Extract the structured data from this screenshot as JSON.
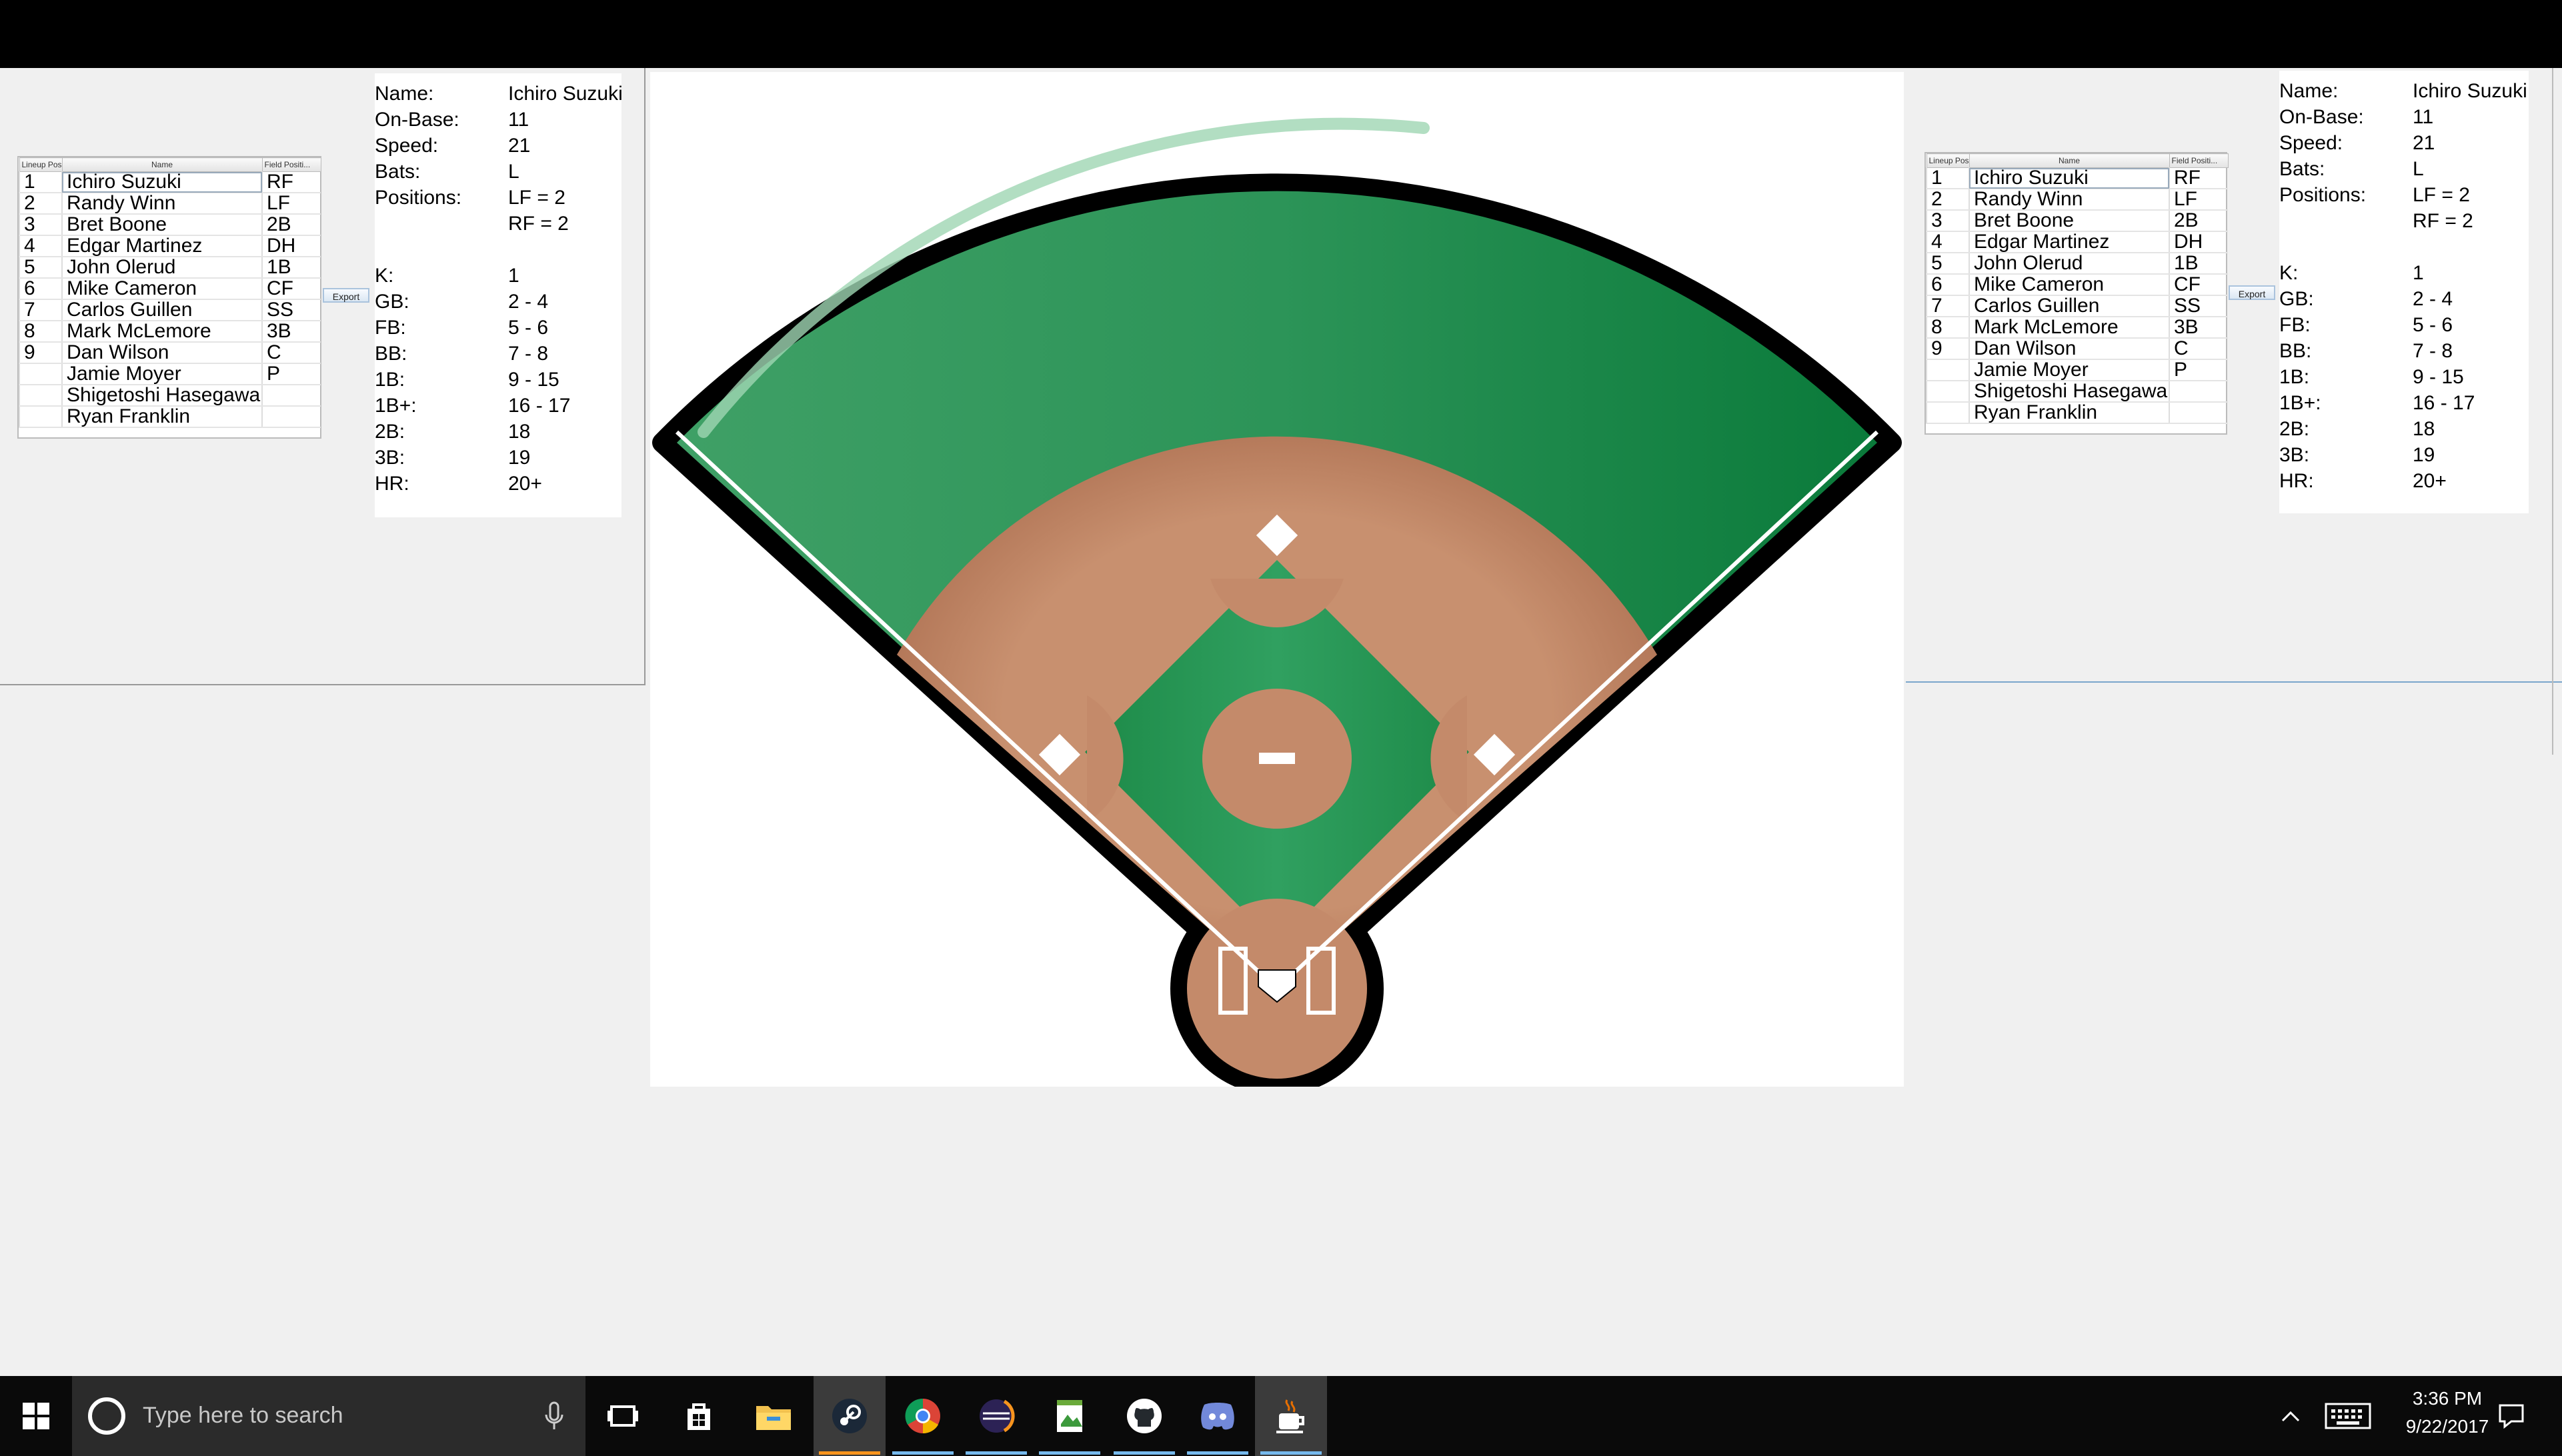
{
  "lineup": {
    "headers": [
      "Lineup Pos...",
      "Name",
      "Field Positi..."
    ],
    "rows": [
      {
        "pos": "1",
        "name": "Ichiro Suzuki",
        "field": "RF"
      },
      {
        "pos": "2",
        "name": "Randy Winn",
        "field": "LF"
      },
      {
        "pos": "3",
        "name": "Bret Boone",
        "field": "2B"
      },
      {
        "pos": "4",
        "name": "Edgar Martinez",
        "field": "DH"
      },
      {
        "pos": "5",
        "name": "John Olerud",
        "field": "1B"
      },
      {
        "pos": "6",
        "name": "Mike Cameron",
        "field": "CF"
      },
      {
        "pos": "7",
        "name": "Carlos Guillen",
        "field": "SS"
      },
      {
        "pos": "8",
        "name": "Mark McLemore",
        "field": "3B"
      },
      {
        "pos": "9",
        "name": "Dan Wilson",
        "field": "C"
      },
      {
        "pos": "",
        "name": "Jamie Moyer",
        "field": "P"
      },
      {
        "pos": "",
        "name": "Shigetoshi Hasegawa",
        "field": ""
      },
      {
        "pos": "",
        "name": "Ryan Franklin",
        "field": ""
      }
    ]
  },
  "export_label": "Export",
  "stats": {
    "rows": [
      {
        "label": "Name:",
        "value": "Ichiro Suzuki"
      },
      {
        "label": "On-Base:",
        "value": "11"
      },
      {
        "label": "Speed:",
        "value": "21"
      },
      {
        "label": "Bats:",
        "value": "L"
      },
      {
        "label": "Positions:",
        "value": "LF = 2"
      },
      {
        "label": "",
        "value": "RF = 2"
      },
      {
        "label": "",
        "value": ""
      },
      {
        "label": "K:",
        "value": "1"
      },
      {
        "label": "GB:",
        "value": "2 - 4"
      },
      {
        "label": "FB:",
        "value": "5 - 6"
      },
      {
        "label": "BB:",
        "value": "7 - 8"
      },
      {
        "label": "1B:",
        "value": "9 - 15"
      },
      {
        "label": "1B+:",
        "value": "16 - 17"
      },
      {
        "label": "2B:",
        "value": "18"
      },
      {
        "label": "3B:",
        "value": "19"
      },
      {
        "label": "HR:",
        "value": "20+"
      }
    ]
  },
  "taskbar": {
    "search_placeholder": "Type here to search",
    "time": "3:36 PM",
    "date": "9/22/2017",
    "apps": [
      "task-view-icon",
      "store-icon",
      "file-explorer-icon",
      "steam-icon",
      "chrome-icon",
      "eclipse-icon",
      "notepad-icon",
      "github-icon",
      "discord-icon",
      "java-icon"
    ]
  },
  "colors": {
    "grass": "#1f8a4c",
    "dirt": "#c48a6a",
    "outline": "#000000",
    "taskbar": "#0a0a0a",
    "accent": "#76b9ed"
  }
}
